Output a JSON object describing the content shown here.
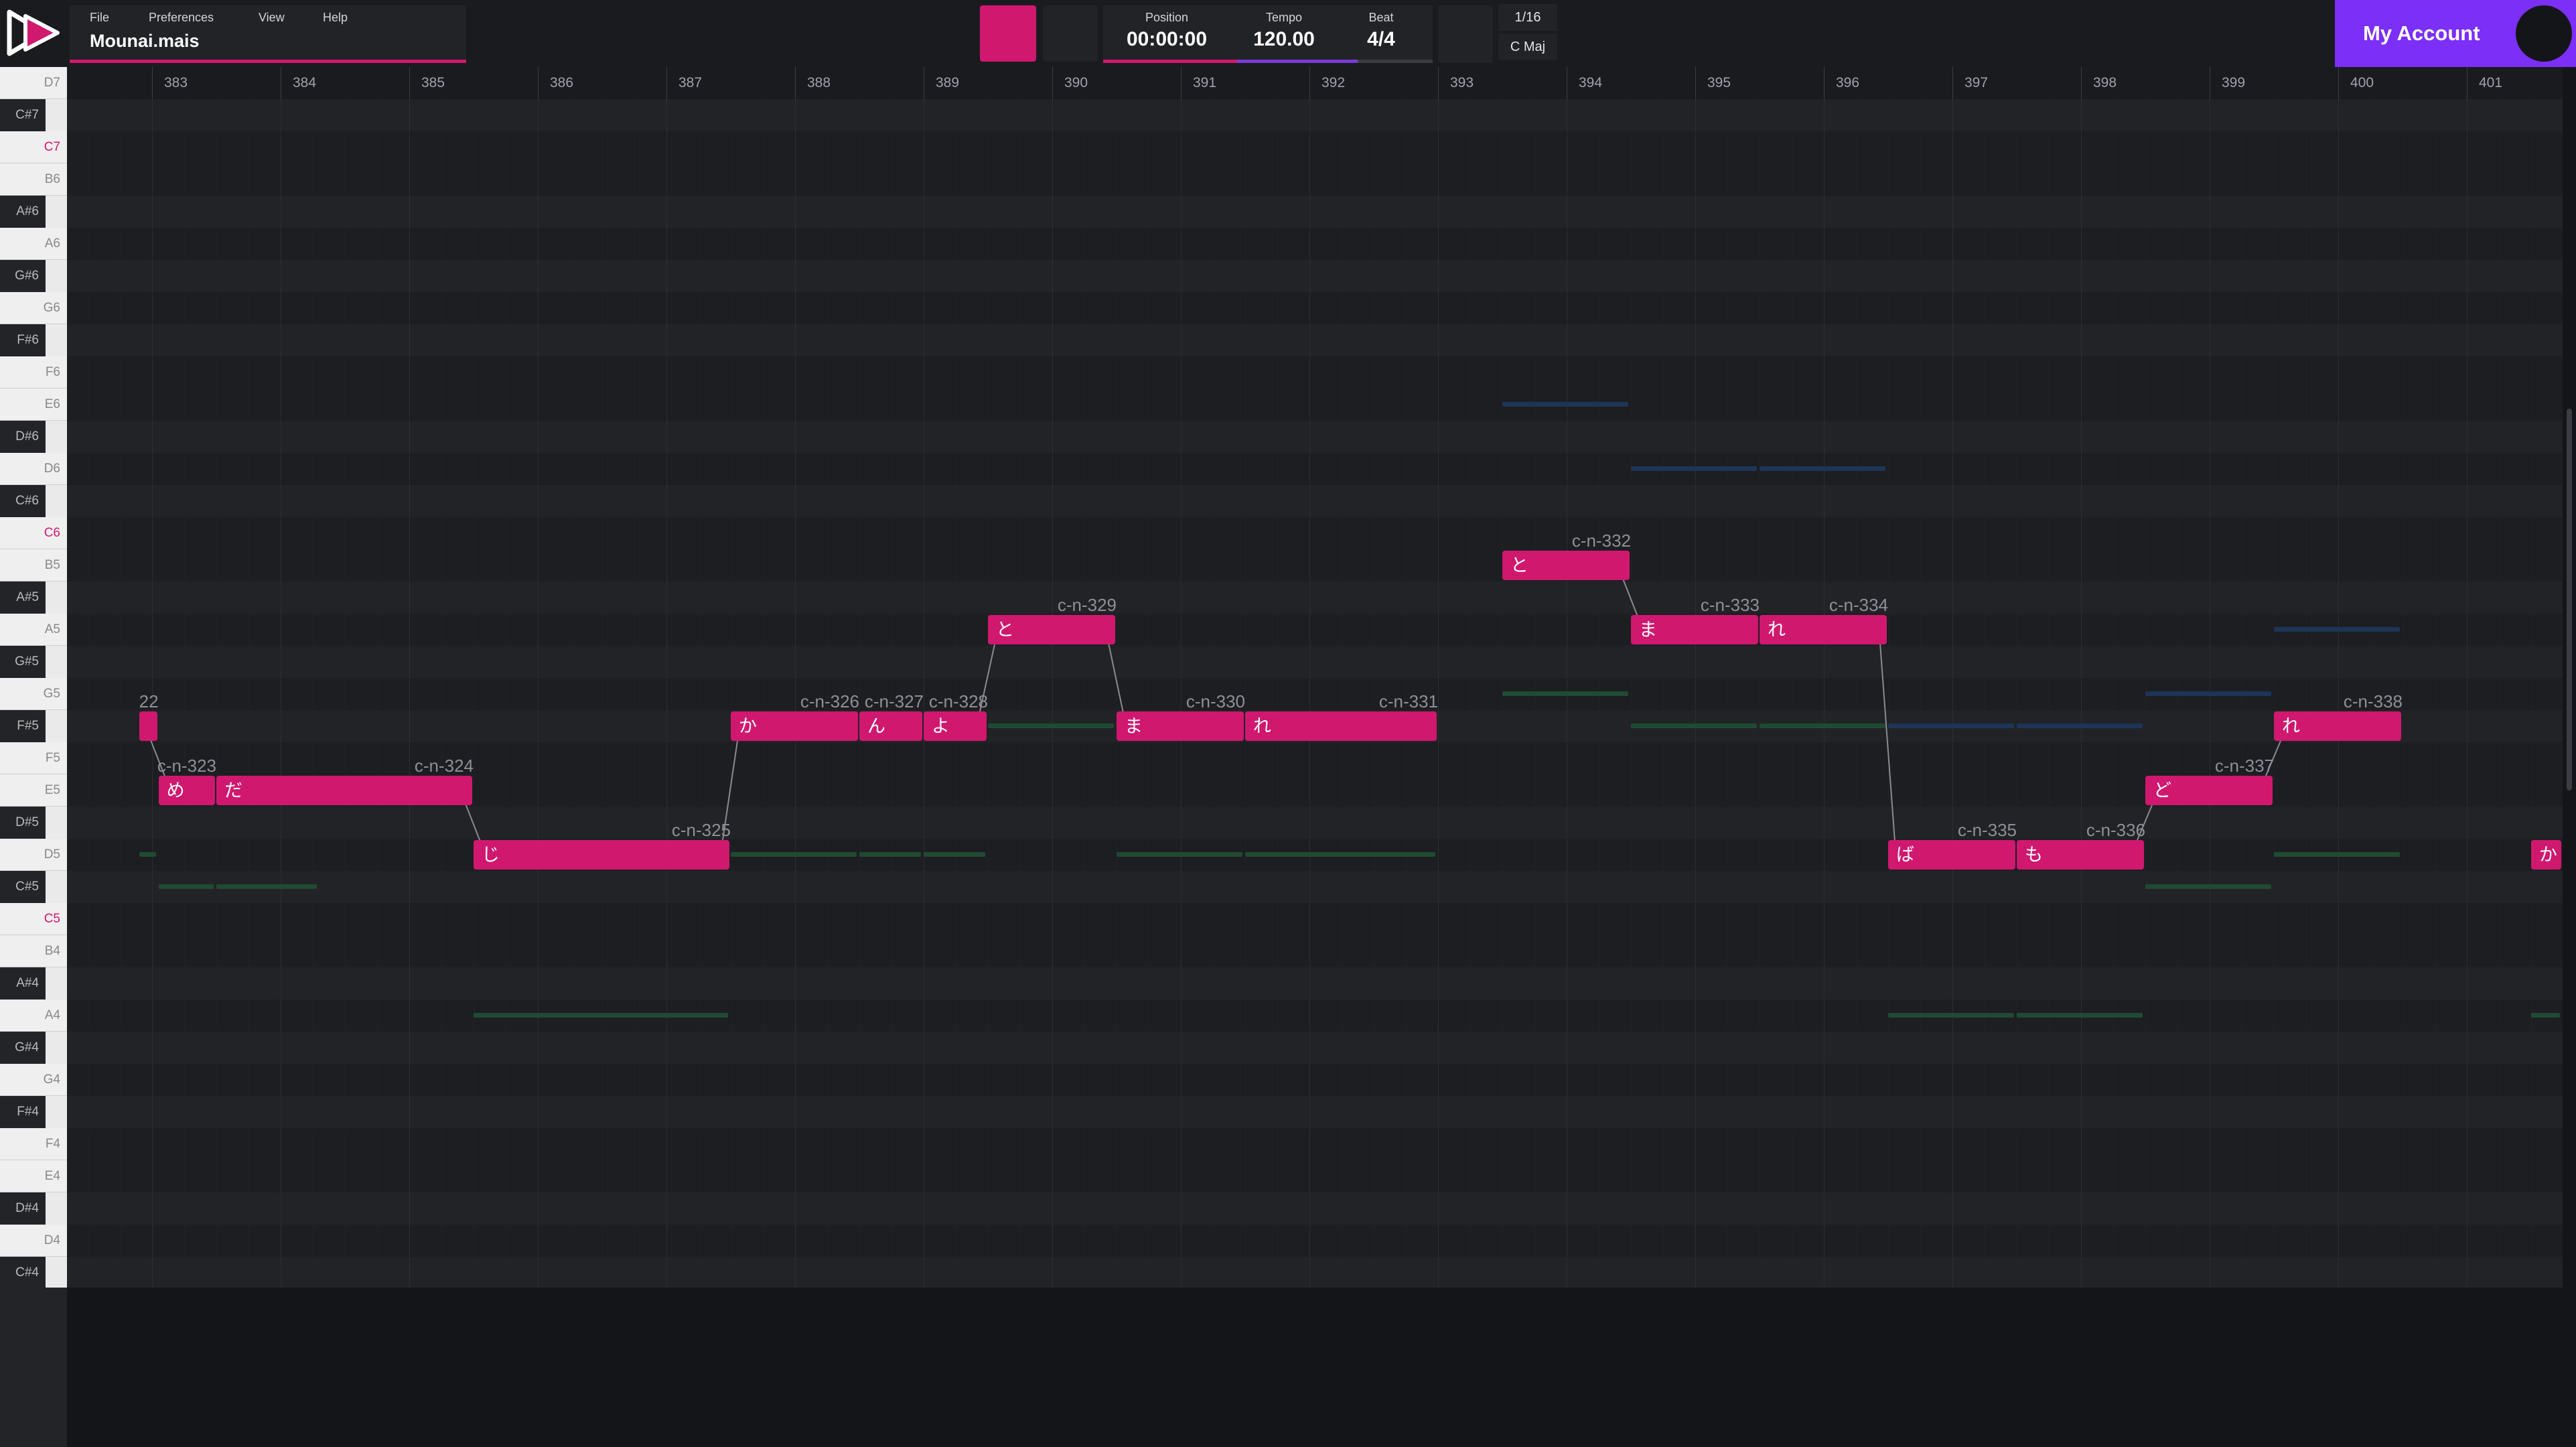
{
  "header": {
    "menu": [
      "File",
      "Preferences",
      "View",
      "Help"
    ],
    "file_name": "Mounai.mais",
    "transport": {
      "position_label": "Position",
      "position": "00:00:00",
      "tempo_label": "Tempo",
      "tempo": "120.00",
      "beat_label": "Beat",
      "beat": "4/4"
    },
    "snap": "1/16",
    "key": "C Maj",
    "account_label": "My Account"
  },
  "colors": {
    "accent": "#d0186f",
    "account": "#7b2ff7",
    "ghost_green": "#1f4a33",
    "ghost_blue": "#1d3556"
  },
  "keyboard": {
    "keys": [
      "D7",
      "C#7",
      "C7",
      "B6",
      "A#6",
      "A6",
      "G#6",
      "G6",
      "F#6",
      "F6",
      "E6",
      "D#6",
      "D6",
      "C#6",
      "C6",
      "B5",
      "A#5",
      "A5",
      "G#5",
      "G5",
      "F#5",
      "F5",
      "E5",
      "D#5",
      "D5",
      "C#5",
      "C5",
      "B4",
      "A#4",
      "A4",
      "G#4",
      "G4",
      "F#4",
      "F4",
      "E4",
      "D#4",
      "D4",
      "C#4"
    ]
  },
  "ruler": {
    "bars": [
      "383",
      "384",
      "385",
      "386",
      "387",
      "388",
      "389",
      "390",
      "391",
      "392",
      "393",
      "394",
      "395",
      "396",
      "397",
      "398",
      "399",
      "400",
      "401"
    ]
  },
  "notes": [
    {
      "id": "22",
      "lyric": "",
      "pitch": "F#5",
      "start": 382.9,
      "end": 383.05
    },
    {
      "id": "c-n-323",
      "lyric": "め",
      "pitch": "E5",
      "start": 383.05,
      "end": 383.5
    },
    {
      "id": "c-n-324",
      "lyric": "だ",
      "pitch": "E5",
      "start": 383.5,
      "end": 385.5
    },
    {
      "id": "c-n-325",
      "lyric": "じ",
      "pitch": "D5",
      "start": 385.5,
      "end": 387.5
    },
    {
      "id": "c-n-326",
      "lyric": "か",
      "pitch": "F#5",
      "start": 387.5,
      "end": 388.5
    },
    {
      "id": "c-n-327",
      "lyric": "ん",
      "pitch": "F#5",
      "start": 388.5,
      "end": 389.0
    },
    {
      "id": "c-n-328",
      "lyric": "よ",
      "pitch": "F#5",
      "start": 389.0,
      "end": 389.5
    },
    {
      "id": "c-n-329",
      "lyric": "と",
      "pitch": "A5",
      "start": 389.5,
      "end": 390.5
    },
    {
      "id": "c-n-330",
      "lyric": "ま",
      "pitch": "F#5",
      "start": 390.5,
      "end": 391.5
    },
    {
      "id": "c-n-331",
      "lyric": "れ",
      "pitch": "F#5",
      "start": 391.5,
      "end": 393.0
    },
    {
      "id": "c-n-332",
      "lyric": "と",
      "pitch": "B5",
      "start": 393.5,
      "end": 394.5
    },
    {
      "id": "c-n-333",
      "lyric": "ま",
      "pitch": "A5",
      "start": 394.5,
      "end": 395.5
    },
    {
      "id": "c-n-334",
      "lyric": "れ",
      "pitch": "A5",
      "start": 395.5,
      "end": 396.5
    },
    {
      "id": "c-n-335",
      "lyric": "ば",
      "pitch": "D5",
      "start": 396.5,
      "end": 397.5
    },
    {
      "id": "c-n-336",
      "lyric": "も",
      "pitch": "D5",
      "start": 397.5,
      "end": 398.5
    },
    {
      "id": "c-n-337",
      "lyric": "ど",
      "pitch": "E5",
      "start": 398.5,
      "end": 399.5
    },
    {
      "id": "c-n-338",
      "lyric": "れ",
      "pitch": "F#5",
      "start": 399.5,
      "end": 400.5
    },
    {
      "id": "",
      "lyric": "か",
      "pitch": "D5",
      "start": 401.5,
      "end": 402.3
    }
  ],
  "ghost_notes": [
    {
      "pitch": "D5",
      "start": 382.9,
      "end": 383.05,
      "color": "green"
    },
    {
      "pitch": "C#5",
      "start": 383.05,
      "end": 383.5,
      "color": "green"
    },
    {
      "pitch": "C#5",
      "start": 383.5,
      "end": 384.3,
      "color": "green"
    },
    {
      "pitch": "A4",
      "start": 385.5,
      "end": 387.5,
      "color": "green"
    },
    {
      "pitch": "D5",
      "start": 387.5,
      "end": 388.5,
      "color": "green"
    },
    {
      "pitch": "D5",
      "start": 388.5,
      "end": 389.0,
      "color": "green"
    },
    {
      "pitch": "D5",
      "start": 389.0,
      "end": 389.5,
      "color": "green"
    },
    {
      "pitch": "F#5",
      "start": 389.5,
      "end": 390.5,
      "color": "green"
    },
    {
      "pitch": "D5",
      "start": 390.5,
      "end": 391.5,
      "color": "green"
    },
    {
      "pitch": "D5",
      "start": 391.5,
      "end": 393.0,
      "color": "green"
    },
    {
      "pitch": "E6",
      "start": 393.5,
      "end": 394.5,
      "color": "blue"
    },
    {
      "pitch": "G5",
      "start": 393.5,
      "end": 394.5,
      "color": "green"
    },
    {
      "pitch": "D6",
      "start": 394.5,
      "end": 395.5,
      "color": "blue"
    },
    {
      "pitch": "D6",
      "start": 395.5,
      "end": 396.5,
      "color": "blue"
    },
    {
      "pitch": "F#5",
      "start": 394.5,
      "end": 395.5,
      "color": "green"
    },
    {
      "pitch": "F#5",
      "start": 395.5,
      "end": 396.5,
      "color": "green"
    },
    {
      "pitch": "F#5",
      "start": 396.5,
      "end": 397.5,
      "color": "blue"
    },
    {
      "pitch": "F#5",
      "start": 397.5,
      "end": 398.5,
      "color": "blue"
    },
    {
      "pitch": "A4",
      "start": 396.5,
      "end": 397.5,
      "color": "green"
    },
    {
      "pitch": "A4",
      "start": 397.5,
      "end": 398.5,
      "color": "green"
    },
    {
      "pitch": "G5",
      "start": 398.5,
      "end": 399.5,
      "color": "blue"
    },
    {
      "pitch": "C#5",
      "start": 398.5,
      "end": 399.5,
      "color": "green"
    },
    {
      "pitch": "A5",
      "start": 399.5,
      "end": 400.5,
      "color": "blue"
    },
    {
      "pitch": "D5",
      "start": 399.5,
      "end": 400.5,
      "color": "green"
    },
    {
      "pitch": "A4",
      "start": 401.5,
      "end": 402.3,
      "color": "green"
    }
  ]
}
